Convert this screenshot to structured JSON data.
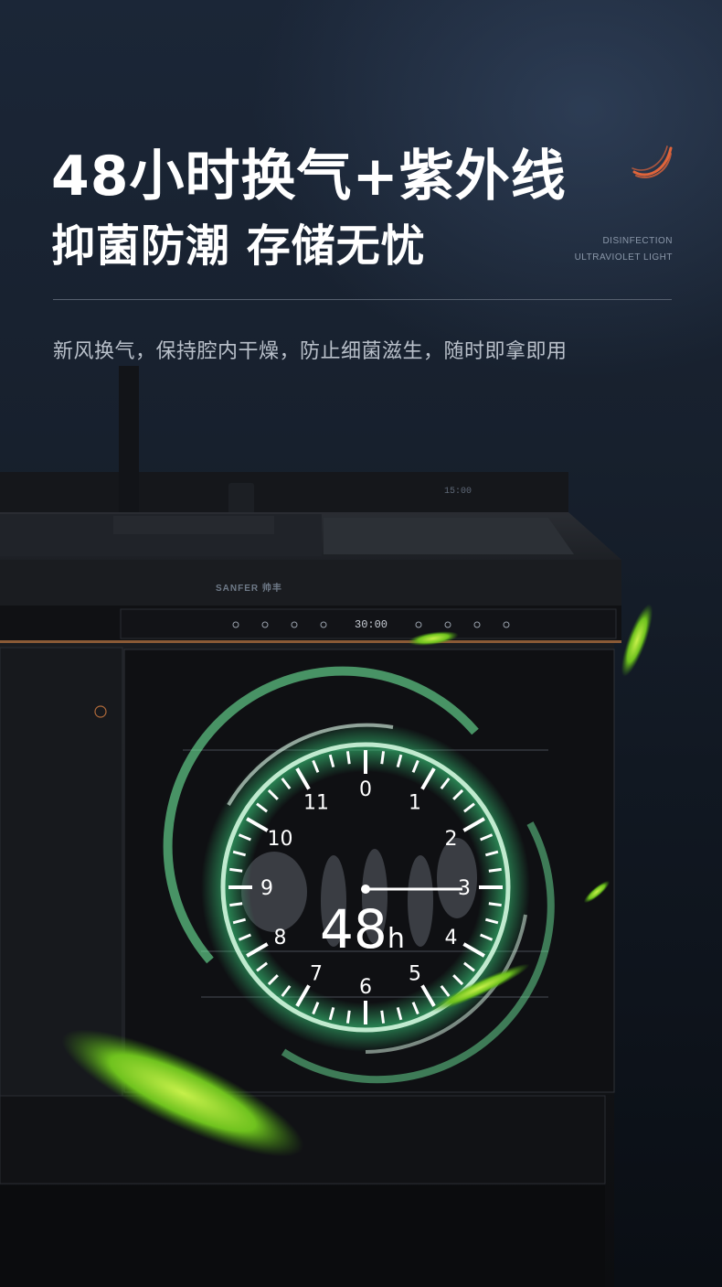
{
  "header": {
    "headline": "48小时换气+紫外线",
    "subheadline": "抑菌防潮 存储无忧",
    "en_line1": "DISINFECTION",
    "en_line2": "ULTRAVIOLET LIGHT",
    "description": "新风换气，保持腔内干燥，防止细菌滋生，随时即拿即用"
  },
  "appliance": {
    "brand": "SANFER 帅丰",
    "panel_time": "30:00",
    "top_time": "15:00"
  },
  "dial": {
    "numbers": [
      "0",
      "1",
      "2",
      "3",
      "4",
      "5",
      "6",
      "7",
      "8",
      "9",
      "10",
      "11"
    ],
    "center_value": "48",
    "center_unit": "h"
  },
  "colors": {
    "accent_orange": "#e0643a",
    "glow_green": "#3ddc84",
    "leaf_green": "#8ed12b"
  }
}
